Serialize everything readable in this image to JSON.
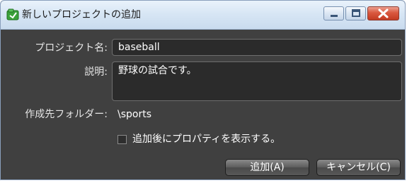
{
  "window": {
    "title": "新しいプロジェクトの追加"
  },
  "form": {
    "project_name_label": "プロジェクト名:",
    "project_name_value": "baseball",
    "description_label": "説明:",
    "description_value": "野球の試合です。",
    "destination_label": "作成先フォルダー:",
    "destination_value": "\\sports",
    "open_props_label": "追加後にプロパティを表示する。",
    "open_props_checked": false
  },
  "buttons": {
    "add_label": "追加(A)",
    "cancel_label": "キャンセル(C)"
  },
  "icons": {
    "app": "new-project-icon",
    "minimize": "minimize-icon",
    "maximize": "maximize-icon",
    "close": "close-icon"
  },
  "colors": {
    "titlebar": "#d6e5f4",
    "body": "#404040",
    "field": "#2b2b2b",
    "close_button": "#d9583f"
  }
}
